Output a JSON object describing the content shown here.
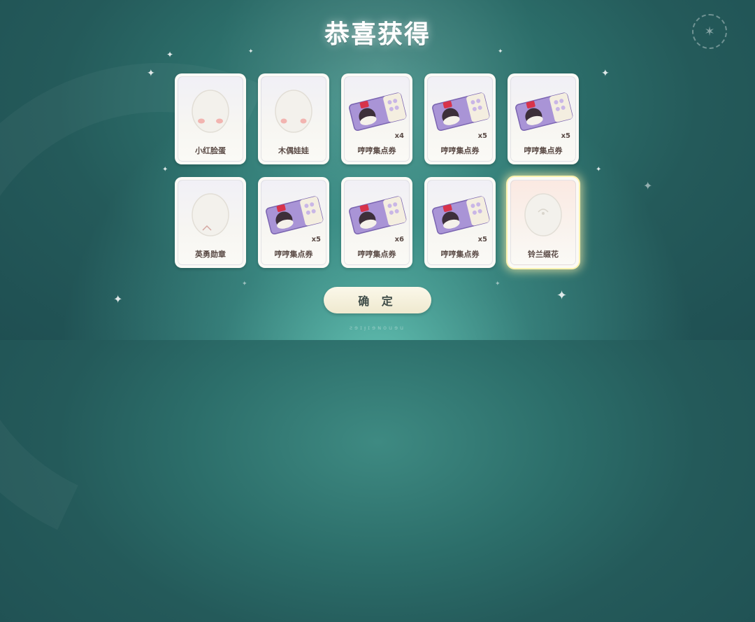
{
  "title": "恭喜获得",
  "confirm_label": "确 定",
  "footer_text": "ƨɘɪɟɪɘɴouɘu",
  "items": [
    {
      "name": "小红脸蛋",
      "quantity": "",
      "icon": "blush-face-icon"
    },
    {
      "name": "木偶娃娃",
      "quantity": "",
      "icon": "puppet-doll-icon"
    },
    {
      "name": "哼哼集点券",
      "quantity": "x4",
      "icon": "coupon-ticket-icon"
    },
    {
      "name": "哼哼集点券",
      "quantity": "x5",
      "icon": "coupon-ticket-icon"
    },
    {
      "name": "哼哼集点券",
      "quantity": "x5",
      "icon": "coupon-ticket-icon"
    },
    {
      "name": "英勇勋章",
      "quantity": "",
      "icon": "medal-icon"
    },
    {
      "name": "哼哼集点券",
      "quantity": "x5",
      "icon": "coupon-ticket-icon"
    },
    {
      "name": "哼哼集点券",
      "quantity": "x6",
      "icon": "coupon-ticket-icon"
    },
    {
      "name": "哼哼集点券",
      "quantity": "x5",
      "icon": "coupon-ticket-icon"
    },
    {
      "name": "铃兰缀花",
      "quantity": "",
      "icon": "lily-flower-icon"
    }
  ],
  "colors": {
    "accent_glow": "#fff3b0",
    "ticket_purple": "#8f78c4",
    "text_brown": "#5a4a45"
  }
}
